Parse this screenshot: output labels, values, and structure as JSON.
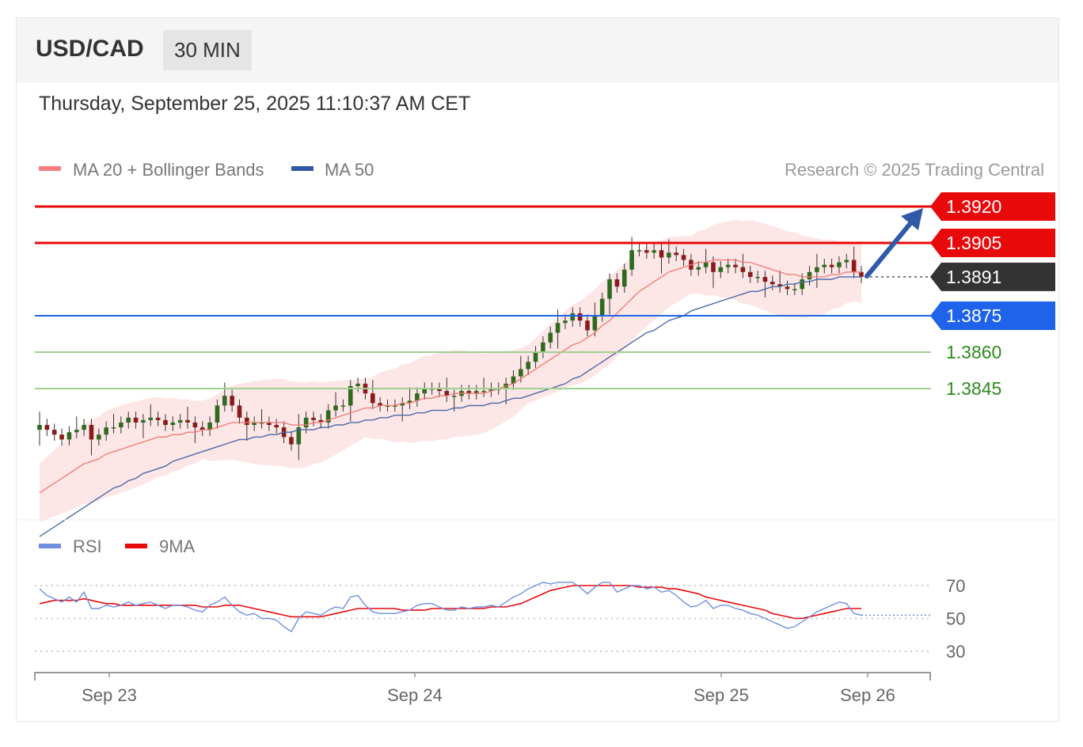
{
  "header": {
    "pair": "USD/CAD",
    "timeframe": "30 MIN",
    "datetime": "Thursday, September 25, 2025 11:10:37 AM CET"
  },
  "legend": {
    "ma20_label": "MA 20 + Bollinger Bands",
    "ma50_label": "MA 50",
    "copyright": "Research © 2025 Trading Central",
    "rsi_label": "RSI",
    "ma9_label": "9MA"
  },
  "colors": {
    "resistance": "#e8090b",
    "current": "#333333",
    "pivot": "#1e63e9",
    "support": "#2e8b1e",
    "support_line": "#9fd08f",
    "ma20": "#f07a70",
    "ma50": "#4a6aa8",
    "band_fill": "#fde3e3",
    "candle_up": "#2e6b1f",
    "candle_down": "#8b1a1a",
    "rsi": "#6f8ee0",
    "rsi_ma": "#e8090b",
    "arrow": "#2f5aa8"
  },
  "chart_data": {
    "type": "candlestick",
    "title": "USD/CAD",
    "timeframe": "30 MIN",
    "x_ticks": [
      "Sep 23",
      "Sep 24",
      "Sep 25",
      "Sep 26"
    ],
    "ylim": [
      1.379,
      1.393
    ],
    "levels": [
      {
        "value": 1.392,
        "label": "1.3920",
        "type": "resistance"
      },
      {
        "value": 1.3905,
        "label": "1.3905",
        "type": "resistance"
      },
      {
        "value": 1.3891,
        "label": "1.3891",
        "type": "current"
      },
      {
        "value": 1.3875,
        "label": "1.3875",
        "type": "pivot"
      },
      {
        "value": 1.386,
        "label": "1.3860",
        "type": "support"
      },
      {
        "value": 1.3845,
        "label": "1.3845",
        "type": "support"
      }
    ],
    "close": [
      1.383,
      1.3828,
      1.3826,
      1.3824,
      1.3827,
      1.3828,
      1.383,
      1.3824,
      1.3826,
      1.3829,
      1.3829,
      1.3831,
      1.3833,
      1.3831,
      1.3832,
      1.3833,
      1.3832,
      1.383,
      1.3831,
      1.3832,
      1.3831,
      1.3829,
      1.3828,
      1.3831,
      1.3838,
      1.3842,
      1.3838,
      1.3833,
      1.383,
      1.3831,
      1.3831,
      1.383,
      1.3829,
      1.3825,
      1.3822,
      1.3829,
      1.3833,
      1.3832,
      1.3831,
      1.3836,
      1.3838,
      1.3838,
      1.3846,
      1.3847,
      1.3843,
      1.3839,
      1.3838,
      1.3838,
      1.3838,
      1.3839,
      1.384,
      1.3843,
      1.3845,
      1.3845,
      1.3844,
      1.3842,
      1.3842,
      1.3844,
      1.3843,
      1.3844,
      1.3844,
      1.3845,
      1.3845,
      1.3847,
      1.385,
      1.3853,
      1.3856,
      1.386,
      1.3864,
      1.3868,
      1.3872,
      1.3873,
      1.3876,
      1.3873,
      1.3869,
      1.3875,
      1.3882,
      1.389,
      1.3887,
      1.3894,
      1.3902,
      1.3902,
      1.3901,
      1.3902,
      1.3899,
      1.3901,
      1.39,
      1.3898,
      1.3894,
      1.3895,
      1.3897,
      1.3893,
      1.3895,
      1.3896,
      1.3895,
      1.3893,
      1.3891,
      1.3891,
      1.3889,
      1.3888,
      1.3887,
      1.3886,
      1.3886,
      1.389,
      1.3893,
      1.3895,
      1.3896,
      1.3895,
      1.3897,
      1.3898,
      1.3893,
      1.3891
    ],
    "ma20": [
      1.3802,
      1.3804,
      1.3806,
      1.3808,
      1.381,
      1.3812,
      1.3814,
      1.3815,
      1.3816,
      1.3818,
      1.3819,
      1.382,
      1.3821,
      1.3822,
      1.3823,
      1.3824,
      1.3825,
      1.3825,
      1.3826,
      1.3826,
      1.3827,
      1.3827,
      1.3828,
      1.3828,
      1.3829,
      1.383,
      1.3831,
      1.3831,
      1.3831,
      1.3831,
      1.3831,
      1.3831,
      1.3831,
      1.3831,
      1.383,
      1.383,
      1.383,
      1.3831,
      1.3831,
      1.3832,
      1.3833,
      1.3834,
      1.3835,
      1.3836,
      1.3837,
      1.3837,
      1.3838,
      1.3838,
      1.3838,
      1.3839,
      1.3839,
      1.384,
      1.3841,
      1.3841,
      1.3842,
      1.3842,
      1.3843,
      1.3843,
      1.3843,
      1.3843,
      1.3843,
      1.3844,
      1.3845,
      1.3846,
      1.3847,
      1.3849,
      1.3851,
      1.3853,
      1.3855,
      1.3857,
      1.3859,
      1.3861,
      1.3863,
      1.3864,
      1.3866,
      1.3868,
      1.3871,
      1.3873,
      1.3876,
      1.3879,
      1.3882,
      1.3885,
      1.3887,
      1.3889,
      1.3891,
      1.3893,
      1.3894,
      1.3895,
      1.3896,
      1.3897,
      1.3897,
      1.3898,
      1.3898,
      1.3898,
      1.3898,
      1.3897,
      1.3897,
      1.3896,
      1.3895,
      1.3894,
      1.3893,
      1.3892,
      1.3892,
      1.3891,
      1.3891,
      1.3891,
      1.3891,
      1.3892,
      1.3892,
      1.3893,
      1.3893,
      1.3893
    ],
    "ma50": [
      1.3784,
      1.3786,
      1.3788,
      1.379,
      1.3792,
      1.3794,
      1.3796,
      1.3798,
      1.38,
      1.3802,
      1.3804,
      1.3805,
      1.3807,
      1.3808,
      1.381,
      1.3811,
      1.3812,
      1.3813,
      1.3815,
      1.3816,
      1.3817,
      1.3818,
      1.3819,
      1.382,
      1.3821,
      1.3822,
      1.3823,
      1.3824,
      1.3824,
      1.3825,
      1.3825,
      1.3826,
      1.3826,
      1.3827,
      1.3827,
      1.3828,
      1.3828,
      1.3828,
      1.3829,
      1.3829,
      1.383,
      1.383,
      1.3831,
      1.3831,
      1.3832,
      1.3832,
      1.3833,
      1.3833,
      1.3834,
      1.3834,
      1.3834,
      1.3835,
      1.3835,
      1.3836,
      1.3836,
      1.3836,
      1.3837,
      1.3837,
      1.3838,
      1.3838,
      1.3838,
      1.3839,
      1.3839,
      1.384,
      1.3841,
      1.3841,
      1.3842,
      1.3843,
      1.3844,
      1.3845,
      1.3846,
      1.3847,
      1.3849,
      1.385,
      1.3852,
      1.3854,
      1.3856,
      1.3858,
      1.386,
      1.3862,
      1.3864,
      1.3866,
      1.3868,
      1.3869,
      1.3871,
      1.3873,
      1.3874,
      1.3875,
      1.3877,
      1.3878,
      1.3879,
      1.388,
      1.3881,
      1.3882,
      1.3883,
      1.3884,
      1.3885,
      1.3885,
      1.3886,
      1.3887,
      1.3887,
      1.3888,
      1.3888,
      1.3889,
      1.3889,
      1.389,
      1.389,
      1.389,
      1.3891,
      1.3891,
      1.3891,
      1.3891
    ],
    "rsi_ticks": [
      70,
      50,
      30
    ],
    "rsi": [
      68,
      64,
      62,
      60,
      63,
      60,
      66,
      56,
      56,
      58,
      57,
      58,
      60,
      58,
      59,
      60,
      58,
      56,
      58,
      58,
      57,
      55,
      54,
      58,
      60,
      63,
      58,
      54,
      52,
      53,
      50,
      50,
      49,
      45,
      42,
      50,
      54,
      53,
      52,
      55,
      57,
      56,
      63,
      64,
      58,
      54,
      53,
      53,
      53,
      54,
      55,
      58,
      59,
      59,
      57,
      55,
      55,
      57,
      56,
      57,
      57,
      58,
      57,
      60,
      63,
      65,
      68,
      70,
      72,
      71,
      72,
      72,
      72,
      69,
      65,
      69,
      72,
      72,
      66,
      68,
      70,
      70,
      68,
      69,
      66,
      67,
      64,
      60,
      57,
      58,
      61,
      56,
      58,
      58,
      56,
      55,
      53,
      52,
      50,
      48,
      46,
      44,
      45,
      48,
      51,
      54,
      56,
      58,
      60,
      59,
      53,
      52
    ],
    "rsi_ma": [
      59,
      60,
      61,
      61,
      61,
      61,
      62,
      61,
      60,
      59,
      59,
      58,
      58,
      58,
      58,
      58,
      58,
      58,
      58,
      58,
      58,
      58,
      57,
      57,
      57,
      58,
      58,
      58,
      57,
      56,
      55,
      54,
      53,
      52,
      51,
      51,
      51,
      51,
      51,
      52,
      53,
      54,
      55,
      56,
      56,
      56,
      56,
      56,
      56,
      55,
      55,
      55,
      55,
      56,
      56,
      56,
      56,
      56,
      56,
      56,
      56,
      57,
      57,
      57,
      58,
      59,
      61,
      63,
      65,
      67,
      68,
      69,
      70,
      70,
      70,
      70,
      70,
      70,
      70,
      70,
      70,
      69,
      69,
      69,
      69,
      68,
      68,
      67,
      66,
      65,
      63,
      62,
      61,
      60,
      59,
      58,
      57,
      56,
      55,
      53,
      52,
      51,
      50,
      50,
      51,
      52,
      53,
      54,
      55,
      56,
      56,
      56
    ]
  }
}
